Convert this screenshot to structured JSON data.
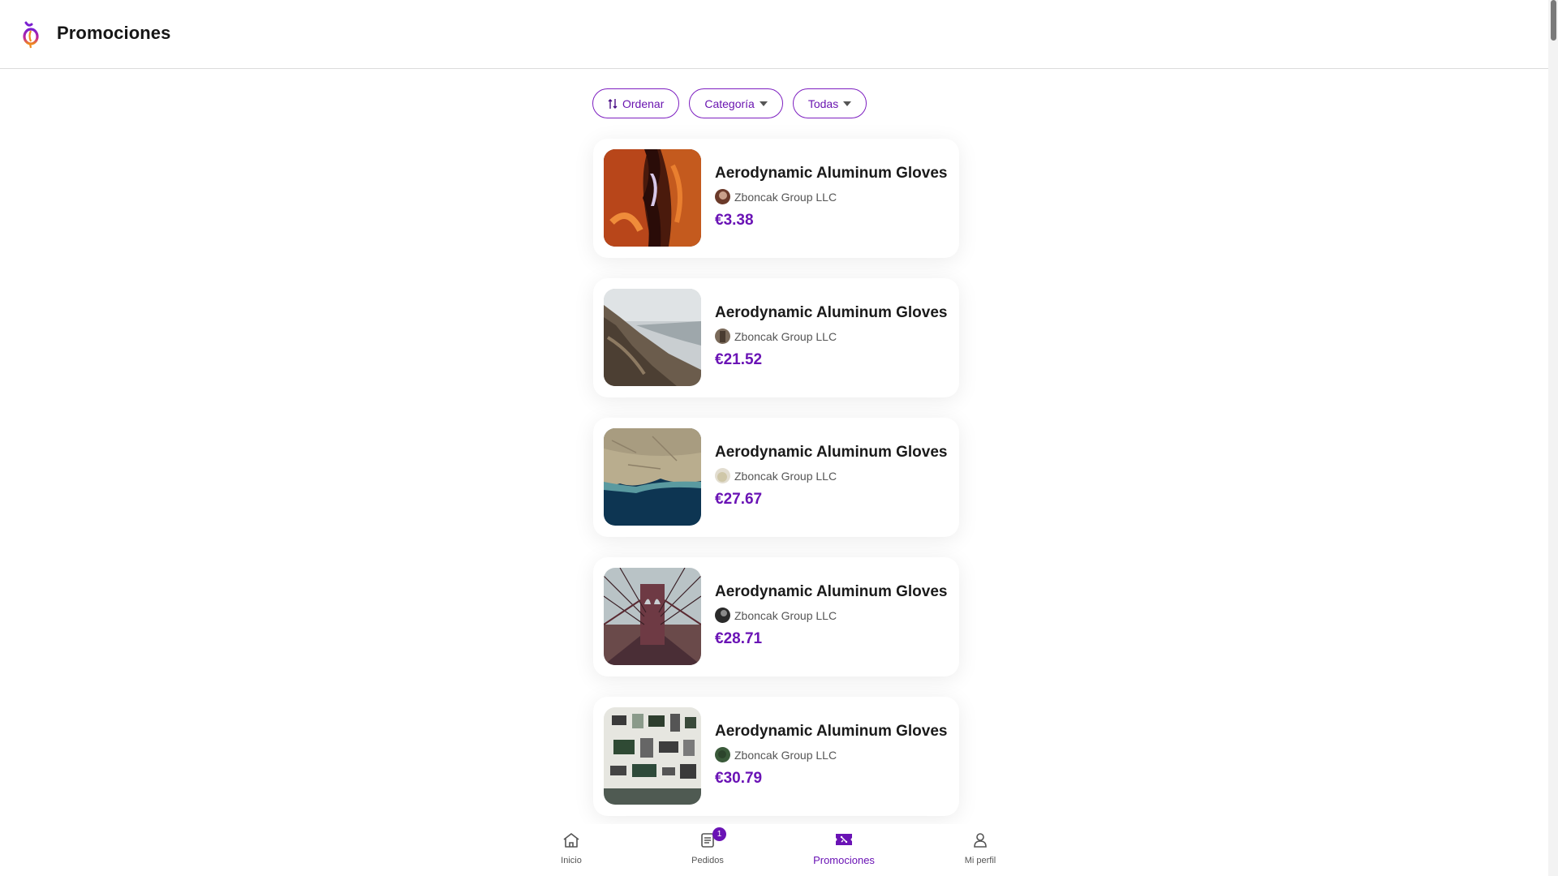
{
  "header": {
    "title": "Promociones"
  },
  "filters": {
    "sort_label": "Ordenar",
    "category_label": "Categoría",
    "scope_label": "Todas"
  },
  "promotions": [
    {
      "title": "Aerodynamic Aluminum Gloves",
      "merchant": "Zboncak Group LLC",
      "price": "€3.38"
    },
    {
      "title": "Aerodynamic Aluminum Gloves",
      "merchant": "Zboncak Group LLC",
      "price": "€21.52"
    },
    {
      "title": "Aerodynamic Aluminum Gloves",
      "merchant": "Zboncak Group LLC",
      "price": "€27.67"
    },
    {
      "title": "Aerodynamic Aluminum Gloves",
      "merchant": "Zboncak Group LLC",
      "price": "€28.71"
    },
    {
      "title": "Aerodynamic Aluminum Gloves",
      "merchant": "Zboncak Group LLC",
      "price": "€30.79"
    }
  ],
  "nav": {
    "home": "Inicio",
    "orders": "Pedidos",
    "orders_badge": "1",
    "promotions": "Promociones",
    "profile": "Mi perfil"
  },
  "colors": {
    "accent": "#6a13b5",
    "border": "#7d1fc0"
  }
}
